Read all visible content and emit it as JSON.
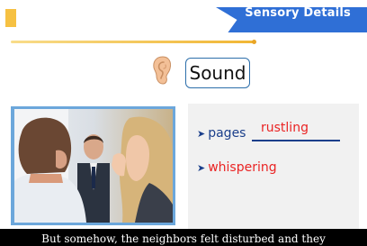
{
  "header": {
    "title": "Sensory Details"
  },
  "main": {
    "sense_label": "Sound",
    "sense_icon": "ear-icon",
    "photo": "people-whispering-photo",
    "bullets": [
      {
        "word": "pages",
        "blank_answer": "rustling"
      },
      {
        "word": "whispering"
      }
    ]
  },
  "subtitle": "But somehow, the neighbors felt disturbed and they",
  "colors": {
    "banner": "#2f6fd6",
    "accent": "#f1b634",
    "label_blue": "#1b3f8b",
    "answer_red": "#ea2424"
  }
}
